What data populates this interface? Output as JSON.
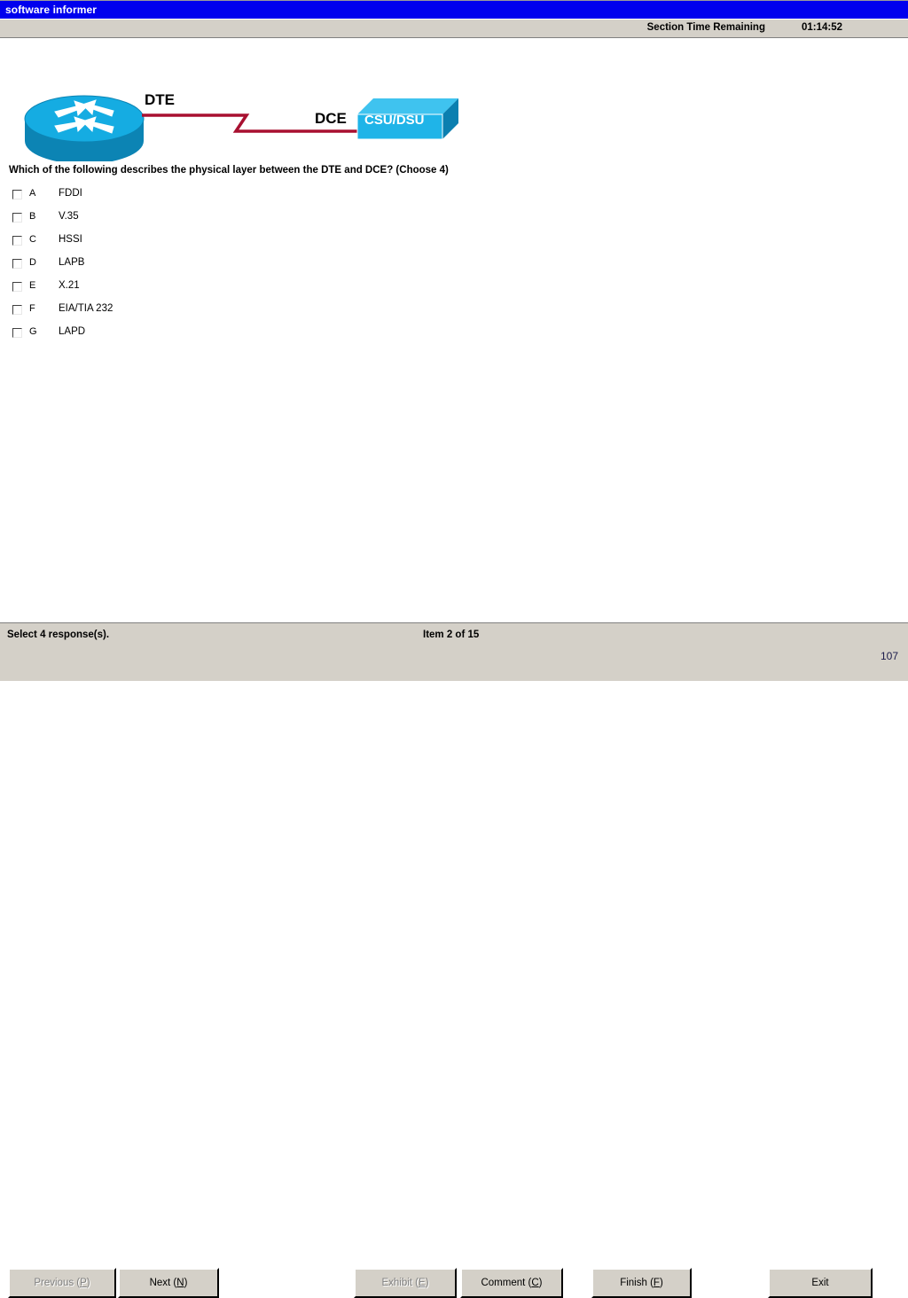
{
  "window": {
    "title": "software informer"
  },
  "status": {
    "timer_label": "Section Time Remaining",
    "timer_value": "01:14:52"
  },
  "diagram": {
    "router_label": "DTE",
    "link_label": "DCE",
    "device_label": "CSU/DSU",
    "router_color": "#0fa8e0",
    "router_side_color": "#0c84b4",
    "device_color": "#1fb4e8",
    "device_side_color": "#0b7fb0",
    "link_color": "#a81030"
  },
  "question": {
    "text": "Which of the following describes the physical layer between the DTE and DCE? (Choose 4)",
    "options": [
      {
        "letter": "A",
        "label": "FDDI",
        "checked": false
      },
      {
        "letter": "B",
        "label": "V.35",
        "checked": false
      },
      {
        "letter": "C",
        "label": "HSSI",
        "checked": false
      },
      {
        "letter": "D",
        "label": "LAPB",
        "checked": false
      },
      {
        "letter": "E",
        "label": "X.21",
        "checked": false
      },
      {
        "letter": "F",
        "label": "EIA/TIA 232",
        "checked": false
      },
      {
        "letter": "G",
        "label": "LAPD",
        "checked": false
      }
    ]
  },
  "footer": {
    "instruction": "Select 4 response(s).",
    "item_counter": "Item 2 of 15",
    "page_number": "107",
    "buttons": {
      "previous": {
        "text": "Previous (P)",
        "mnemonic": "P",
        "disabled": true
      },
      "next": {
        "text": "Next (N)",
        "mnemonic": "N",
        "disabled": false
      },
      "exhibit": {
        "text": "Exhibit (E)",
        "mnemonic": "E",
        "disabled": true
      },
      "comment": {
        "text": "Comment (C)",
        "mnemonic": "C",
        "disabled": false
      },
      "finish": {
        "text": "Finish (F)",
        "mnemonic": "F",
        "disabled": false
      },
      "exit": {
        "text": "Exit",
        "mnemonic": "",
        "disabled": false
      }
    }
  }
}
